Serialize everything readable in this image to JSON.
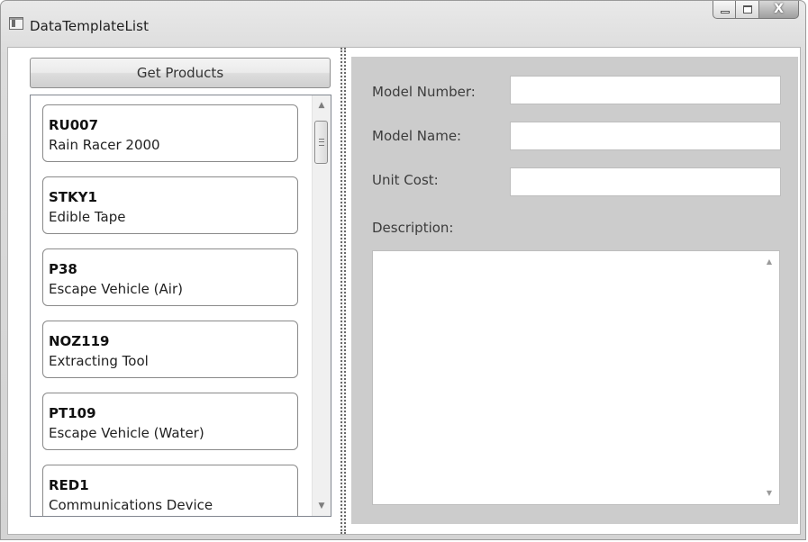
{
  "window": {
    "title": "DataTemplateList",
    "controls": {
      "minimize": "minimize",
      "maximize": "maximize",
      "close": "X"
    }
  },
  "toolbar": {
    "get_products_label": "Get Products"
  },
  "products": [
    {
      "code": "RU007",
      "name": "Rain Racer 2000"
    },
    {
      "code": "STKY1",
      "name": "Edible Tape"
    },
    {
      "code": "P38",
      "name": "Escape Vehicle (Air)"
    },
    {
      "code": "NOZ119",
      "name": "Extracting Tool"
    },
    {
      "code": "PT109",
      "name": "Escape Vehicle (Water)"
    },
    {
      "code": "RED1",
      "name": "Communications Device"
    }
  ],
  "details": {
    "model_number_label": "Model Number:",
    "model_number_value": "",
    "model_name_label": "Model Name:",
    "model_name_value": "",
    "unit_cost_label": "Unit Cost:",
    "unit_cost_value": "",
    "description_label": "Description:",
    "description_value": ""
  },
  "colors": {
    "detail_background": "#cccccc",
    "field_background": "#ffffff",
    "item_border": "#8a8a8a"
  },
  "icons": {
    "app": "window-app-icon",
    "scroll_up": "scroll-up-arrow-icon",
    "scroll_down": "scroll-down-arrow-icon"
  }
}
